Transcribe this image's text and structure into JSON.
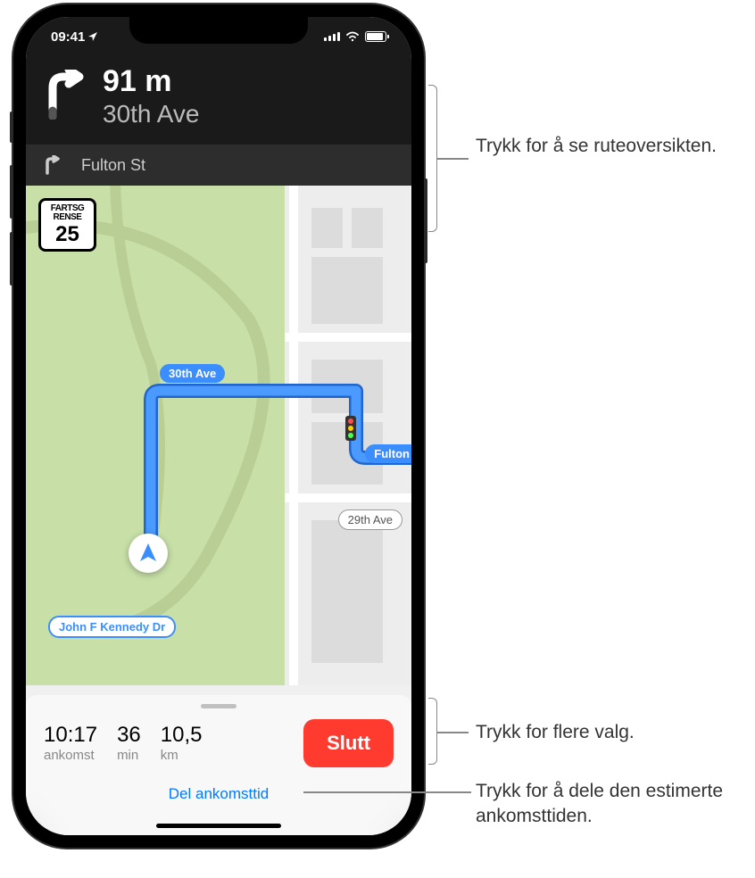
{
  "status_bar": {
    "time": "09:41",
    "location_arrow": "↗"
  },
  "direction": {
    "distance": "91 m",
    "street": "30th Ave"
  },
  "next_direction": {
    "street": "Fulton St"
  },
  "speed_limit": {
    "label_line1": "FARTSG",
    "label_line2": "RENSE",
    "value": "25"
  },
  "map_labels": {
    "street_30th": "30th Ave",
    "street_fulton": "Fulton",
    "street_29th": "29th Ave",
    "street_jfk": "John F Kennedy Dr"
  },
  "bottom_panel": {
    "arrival": {
      "value": "10:17",
      "label": "ankomst"
    },
    "duration": {
      "value": "36",
      "label": "min"
    },
    "distance": {
      "value": "10,5",
      "label": "km"
    },
    "end_button": "Slutt",
    "share_eta": "Del ankomsttid"
  },
  "callouts": {
    "route_overview": "Trykk for å se ruteoversikten.",
    "more_options": "Trykk for flere valg.",
    "share_eta": "Trykk for å dele den estimerte ankomsttiden."
  }
}
